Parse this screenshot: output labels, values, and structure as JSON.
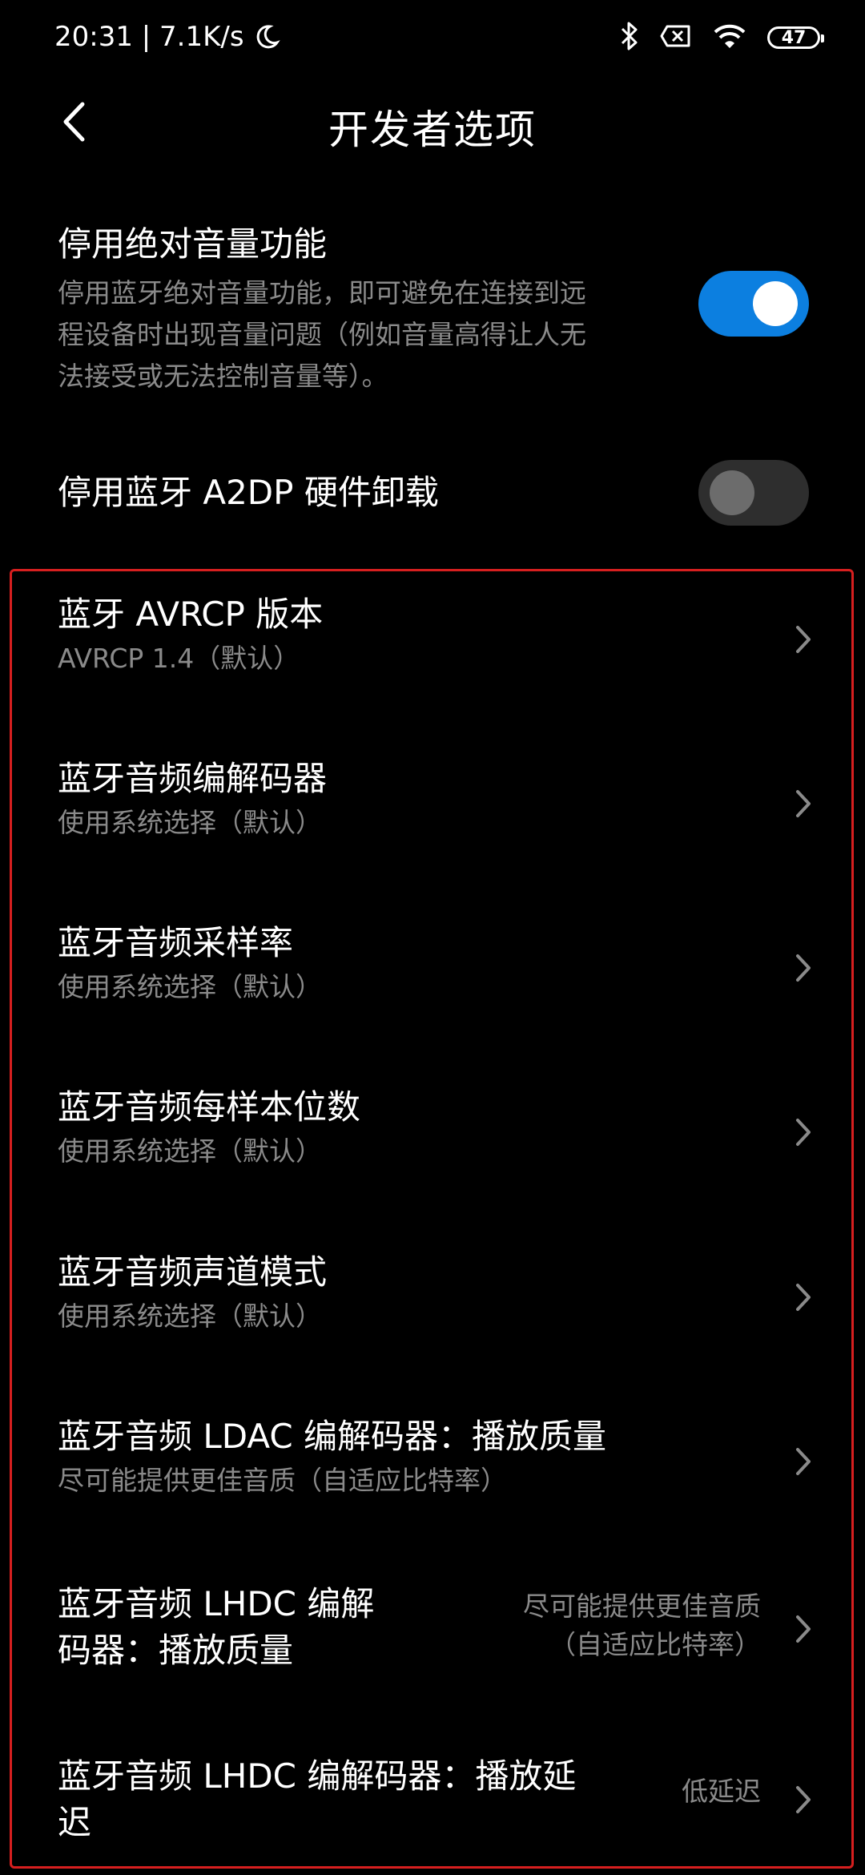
{
  "status_bar": {
    "time_speed": "20:31 | 7.1K/s",
    "battery": "47",
    "icons": [
      "moon-icon",
      "bluetooth-icon",
      "sim-off-icon",
      "wifi-icon",
      "battery-icon"
    ]
  },
  "header": {
    "title": "开发者选项",
    "back_icon": "chevron-left-icon"
  },
  "toggles": [
    {
      "title": "停用绝对音量功能",
      "description_lines": [
        "停用蓝牙绝对音量功能，即可避免在连接到远",
        "程设备时出现音量问题（例如音量高得让人无",
        "法接受或无法控制音量等）。"
      ],
      "state": "on"
    },
    {
      "title": "停用蓝牙 A2DP 硬件卸载",
      "state": "off"
    }
  ],
  "items": [
    {
      "title": "蓝牙 AVRCP 版本",
      "subtitle": "AVRCP 1.4（默认）"
    },
    {
      "title": "蓝牙音频编解码器",
      "subtitle": "使用系统选择（默认）"
    },
    {
      "title": "蓝牙音频采样率",
      "subtitle": "使用系统选择（默认）"
    },
    {
      "title": "蓝牙音频每样本位数",
      "subtitle": "使用系统选择（默认）"
    },
    {
      "title": "蓝牙音频声道模式",
      "subtitle": "使用系统选择（默认）"
    },
    {
      "title": "蓝牙音频 LDAC 编解码器：播放质量",
      "subtitle": "尽可能提供更佳音质（自适应比特率）"
    },
    {
      "title_lines": [
        "蓝牙音频 LHDC 编解",
        "码器：播放质量"
      ],
      "value_lines": [
        "尽可能提供更佳音质",
        "（自适应比特率）"
      ]
    },
    {
      "title_lines": [
        "蓝牙音频 LHDC 编解码器：播放延",
        "迟"
      ],
      "value": "低延迟"
    }
  ],
  "colors": {
    "background": "#000000",
    "accent": "#0c7fe0",
    "secondary_text": "#8a8a8a",
    "highlight_border": "#d61f1f"
  }
}
